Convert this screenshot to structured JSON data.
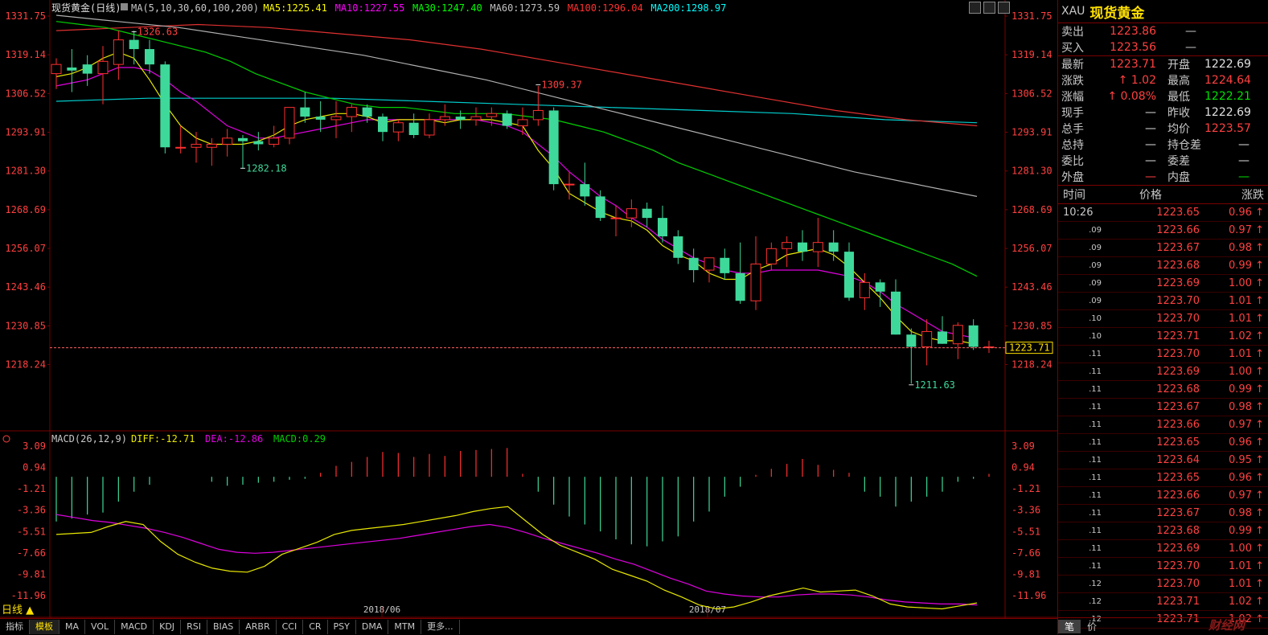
{
  "chart_title": {
    "symbol": "现货黄金",
    "period": "日线",
    "ma_spec": "MA(5,10,30,60,100,200)",
    "ma": [
      {
        "label": "MA5:1225.41",
        "color": "#ffff00"
      },
      {
        "label": "MA10:1227.55",
        "color": "#ff00ff"
      },
      {
        "label": "MA30:1247.40",
        "color": "#00ff00"
      },
      {
        "label": "MA60:1273.59",
        "color": "#c0c0c0"
      },
      {
        "label": "MA100:1296.04",
        "color": "#ff3030"
      },
      {
        "label": "MA200:1298.97",
        "color": "#00ffff"
      }
    ]
  },
  "macd_title": {
    "spec": "MACD(26,12,9)",
    "diff": "DIFF:-12.71",
    "dea": "DEA:-12.86",
    "macd": "MACD:0.29"
  },
  "chart_data": {
    "type": "candlestick",
    "y_labels": [
      "1331.75",
      "1319.14",
      "1306.52",
      "1293.91",
      "1281.30",
      "1268.69",
      "1256.07",
      "1243.46",
      "1230.85",
      "1218.24"
    ],
    "ylim": [
      1210,
      1331.75
    ],
    "x_labels": [
      "2018/06",
      "2018/07"
    ],
    "current_price": "1223.71",
    "annotations": [
      {
        "label": "1326.63",
        "index": 5,
        "price": 1326.63
      },
      {
        "label": "1282.18",
        "index": 12,
        "price": 1282.18
      },
      {
        "label": "1309.37",
        "index": 31,
        "price": 1309.37
      },
      {
        "label": "1211.63",
        "index": 55,
        "price": 1211.63
      }
    ],
    "candles": [
      [
        1313,
        1318,
        1308,
        1316
      ],
      [
        1315,
        1321,
        1307,
        1314
      ],
      [
        1316,
        1319,
        1309,
        1313
      ],
      [
        1313,
        1322,
        1303,
        1317
      ],
      [
        1316,
        1327,
        1311,
        1324
      ],
      [
        1324,
        1327,
        1316,
        1321
      ],
      [
        1321,
        1324,
        1313,
        1316
      ],
      [
        1316,
        1317,
        1287,
        1289
      ],
      [
        1289,
        1296,
        1287,
        1289
      ],
      [
        1289,
        1294,
        1284,
        1290
      ],
      [
        1289,
        1292,
        1283,
        1290
      ],
      [
        1290,
        1295,
        1286,
        1292
      ],
      [
        1292,
        1293,
        1282,
        1291
      ],
      [
        1291,
        1294,
        1288,
        1290
      ],
      [
        1290,
        1296,
        1289,
        1292
      ],
      [
        1292,
        1302,
        1290,
        1302
      ],
      [
        1302,
        1307,
        1297,
        1299
      ],
      [
        1299,
        1304,
        1294,
        1298
      ],
      [
        1298,
        1304,
        1292,
        1299
      ],
      [
        1299,
        1303,
        1294,
        1302
      ],
      [
        1302,
        1303,
        1297,
        1299
      ],
      [
        1299,
        1300,
        1291,
        1294
      ],
      [
        1294,
        1298,
        1291,
        1297
      ],
      [
        1297,
        1300,
        1292,
        1293
      ],
      [
        1293,
        1300,
        1292,
        1298
      ],
      [
        1298,
        1303,
        1296,
        1299
      ],
      [
        1299,
        1301,
        1295,
        1298
      ],
      [
        1298,
        1302,
        1296,
        1299
      ],
      [
        1299,
        1302,
        1296,
        1300
      ],
      [
        1300,
        1301,
        1295,
        1296
      ],
      [
        1296,
        1302,
        1293,
        1298
      ],
      [
        1298,
        1309,
        1296,
        1301
      ],
      [
        1301,
        1302,
        1275,
        1277
      ],
      [
        1277,
        1281,
        1272,
        1277
      ],
      [
        1277,
        1284,
        1270,
        1273
      ],
      [
        1273,
        1275,
        1265,
        1266
      ],
      [
        1266,
        1270,
        1260,
        1266
      ],
      [
        1266,
        1272,
        1263,
        1269
      ],
      [
        1269,
        1271,
        1263,
        1266
      ],
      [
        1266,
        1270,
        1258,
        1260
      ],
      [
        1260,
        1262,
        1251,
        1253
      ],
      [
        1253,
        1256,
        1245,
        1249
      ],
      [
        1249,
        1253,
        1245,
        1253
      ],
      [
        1253,
        1256,
        1246,
        1248
      ],
      [
        1248,
        1258,
        1238,
        1239
      ],
      [
        1239,
        1260,
        1236,
        1251
      ],
      [
        1251,
        1258,
        1249,
        1256
      ],
      [
        1256,
        1260,
        1250,
        1258
      ],
      [
        1258,
        1262,
        1252,
        1255
      ],
      [
        1255,
        1266,
        1250,
        1258
      ],
      [
        1258,
        1262,
        1252,
        1255
      ],
      [
        1255,
        1258,
        1239,
        1240
      ],
      [
        1240,
        1248,
        1236,
        1245
      ],
      [
        1245,
        1246,
        1237,
        1242
      ],
      [
        1242,
        1246,
        1228,
        1228
      ],
      [
        1228,
        1230,
        1212,
        1224
      ],
      [
        1224,
        1233,
        1218,
        1229
      ],
      [
        1229,
        1234,
        1225,
        1225
      ],
      [
        1225,
        1232,
        1220,
        1231
      ],
      [
        1231,
        1233,
        1223,
        1224
      ],
      [
        1224,
        1226,
        1222,
        1224
      ]
    ],
    "ma5": [
      1312,
      1313,
      1315,
      1318,
      1320,
      1318,
      1311,
      1303,
      1296,
      1292,
      1290,
      1290,
      1290,
      1291,
      1293,
      1296,
      1298,
      1299,
      1300,
      1300,
      1299,
      1297,
      1298,
      1298,
      1298,
      1297,
      1298,
      1298,
      1298,
      1297,
      1296,
      1288,
      1282,
      1274,
      1271,
      1268,
      1266,
      1265,
      1262,
      1257,
      1254,
      1252,
      1248,
      1246,
      1246,
      1249,
      1251,
      1254,
      1255,
      1256,
      1254,
      1250,
      1245,
      1240,
      1234,
      1229,
      1227,
      1226,
      1226,
      1225
    ],
    "ma10": [
      1309,
      1310,
      1311,
      1313,
      1315,
      1315,
      1314,
      1311,
      1307,
      1304,
      1300,
      1296,
      1294,
      1292,
      1292,
      1293,
      1294,
      1295,
      1296,
      1297,
      1298,
      1298,
      1298,
      1298,
      1298,
      1298,
      1298,
      1298,
      1297,
      1296,
      1294,
      1290,
      1286,
      1281,
      1277,
      1273,
      1270,
      1266,
      1263,
      1259,
      1256,
      1253,
      1251,
      1249,
      1248,
      1248,
      1249,
      1249,
      1249,
      1249,
      1248,
      1247,
      1245,
      1242,
      1238,
      1235,
      1232,
      1229,
      1228,
      1227
    ],
    "ma30": [
      1330,
      1329,
      1328,
      1326,
      1324,
      1322,
      1320,
      1317,
      1313,
      1310,
      1307,
      1305,
      1303,
      1302,
      1302,
      1301,
      1300,
      1300,
      1300,
      1299,
      1298,
      1296,
      1294,
      1291,
      1288,
      1284,
      1281,
      1278,
      1275,
      1272,
      1269,
      1266,
      1263,
      1260,
      1257,
      1254,
      1251,
      1247
    ],
    "ma60": [
      1332,
      1330,
      1328,
      1325,
      1322,
      1319,
      1315,
      1311,
      1306,
      1301,
      1296,
      1291,
      1286,
      1281,
      1277,
      1273
    ],
    "ma100": [
      1327,
      1328,
      1329,
      1328,
      1326,
      1324,
      1321,
      1317,
      1313,
      1309,
      1305,
      1301,
      1298,
      1296
    ],
    "ma200": [
      1304,
      1305,
      1305,
      1305,
      1304,
      1303,
      1302,
      1301,
      1300,
      1298,
      1297
    ],
    "macd_y_labels": [
      "3.09",
      "0.94",
      "-1.21",
      "-3.36",
      "-5.51",
      "-7.66",
      "-9.81",
      "-11.96"
    ],
    "macd_ylim": [
      -13.5,
      3.09
    ],
    "macd_hist": [
      -4.5,
      -4.2,
      -3.8,
      -3.6,
      -2.5,
      -1.5,
      -0.8,
      0,
      0,
      0,
      -0.5,
      -0.9,
      -0.8,
      -0.6,
      -0.5,
      -0.3,
      -0.2,
      0.4,
      1.1,
      1.5,
      2.0,
      2.5,
      2.4,
      2.0,
      2.3,
      2.1,
      2.6,
      2.7,
      2.8,
      2.9,
      0.3,
      -1.5,
      -2.8,
      -4.0,
      -4.8,
      -5.5,
      -6.3,
      -6.8,
      -7.0,
      -6.5,
      -6.0,
      -4.5,
      -3.5,
      -2.0,
      -1.0,
      0.2,
      0.8,
      1.3,
      1.8,
      1.2,
      0.7,
      0.4,
      -1.5,
      -2.0,
      -3.0,
      -2.5,
      -2.0,
      -1.5,
      -0.5,
      -0.2,
      0.3
    ],
    "diff": [
      -5.8,
      -5.7,
      -5.6,
      -5.0,
      -4.5,
      -4.8,
      -6.5,
      -7.8,
      -8.6,
      -9.2,
      -9.5,
      -9.6,
      -9.0,
      -7.8,
      -7.2,
      -6.6,
      -5.8,
      -5.4,
      -5.2,
      -5.0,
      -4.8,
      -4.5,
      -4.2,
      -3.9,
      -3.5,
      -3.2,
      -3.0,
      -4.4,
      -5.8,
      -6.9,
      -7.6,
      -8.3,
      -9.3,
      -9.9,
      -10.5,
      -11.4,
      -12.1,
      -12.9,
      -13.3,
      -13.1,
      -12.6,
      -12.0,
      -11.6,
      -11.2,
      -11.6,
      -11.5,
      -11.4,
      -12.0,
      -12.8,
      -13.1,
      -13.2,
      -13.3,
      -13.0,
      -12.7
    ],
    "dea": [
      -3.8,
      -4.1,
      -4.4,
      -4.6,
      -4.9,
      -5.2,
      -5.6,
      -6.1,
      -6.7,
      -7.3,
      -7.6,
      -7.7,
      -7.6,
      -7.4,
      -7.2,
      -7.0,
      -6.8,
      -6.6,
      -6.4,
      -6.2,
      -5.9,
      -5.6,
      -5.3,
      -5.0,
      -4.8,
      -5.1,
      -5.6,
      -6.2,
      -6.7,
      -7.2,
      -7.7,
      -8.3,
      -8.8,
      -9.5,
      -10.2,
      -10.8,
      -11.5,
      -11.8,
      -12.0,
      -12.1,
      -12.1,
      -11.9,
      -11.8,
      -11.8,
      -11.9,
      -12.1,
      -12.4,
      -12.6,
      -12.7,
      -12.8,
      -12.8,
      -12.9
    ],
    "colors": {
      "up": "#ff3030",
      "down": "#3ed99a",
      "flat": "#ff3030"
    }
  },
  "side": {
    "code": "XAU",
    "name": "现货黄金",
    "top_rows": [
      {
        "label": "卖出",
        "value": "1223.86",
        "dash": "—"
      },
      {
        "label": "买入",
        "value": "1223.56",
        "dash": "—"
      }
    ],
    "stats": [
      {
        "l1": "最新",
        "v1": "1223.71",
        "c1": "red",
        "l2": "开盘",
        "v2": "1222.69",
        "c2": "white"
      },
      {
        "l1": "涨跌",
        "v1": "1.02",
        "c1": "red",
        "arrow": "↑",
        "l2": "最高",
        "v2": "1224.64",
        "c2": "red"
      },
      {
        "l1": "涨幅",
        "v1": "0.08%",
        "c1": "red",
        "arrow": "↑",
        "l2": "最低",
        "v2": "1222.21",
        "c2": "green"
      },
      {
        "l1": "现手",
        "v1": "—",
        "c1": "white",
        "l2": "昨收",
        "v2": "1222.69",
        "c2": "white"
      },
      {
        "l1": "总手",
        "v1": "—",
        "c1": "white",
        "l2": "均价",
        "v2": "1223.57",
        "c2": "red"
      },
      {
        "l1": "总持",
        "v1": "—",
        "c1": "white",
        "l2": "持仓差",
        "v2": "—",
        "c2": "white"
      },
      {
        "l1": "委比",
        "v1": "—",
        "c1": "white",
        "l2": "委差",
        "v2": "—",
        "c2": "white"
      },
      {
        "l1": "外盘",
        "v1": "—",
        "c1": "red",
        "l2": "内盘",
        "v2": "—",
        "c2": "green"
      }
    ],
    "tick_header": {
      "time": "时间",
      "price": "价格",
      "change": "涨跌"
    },
    "ticks": [
      {
        "time": "10:26",
        "price": "1223.65",
        "chg": "0.96"
      },
      {
        "time": ".09",
        "price": "1223.66",
        "chg": "0.97"
      },
      {
        "time": ".09",
        "price": "1223.67",
        "chg": "0.98"
      },
      {
        "time": ".09",
        "price": "1223.68",
        "chg": "0.99"
      },
      {
        "time": ".09",
        "price": "1223.69",
        "chg": "1.00"
      },
      {
        "time": ".09",
        "price": "1223.70",
        "chg": "1.01"
      },
      {
        "time": ".10",
        "price": "1223.70",
        "chg": "1.01"
      },
      {
        "time": ".10",
        "price": "1223.71",
        "chg": "1.02"
      },
      {
        "time": ".11",
        "price": "1223.70",
        "chg": "1.01"
      },
      {
        "time": ".11",
        "price": "1223.69",
        "chg": "1.00"
      },
      {
        "time": ".11",
        "price": "1223.68",
        "chg": "0.99"
      },
      {
        "time": ".11",
        "price": "1223.67",
        "chg": "0.98"
      },
      {
        "time": ".11",
        "price": "1223.66",
        "chg": "0.97"
      },
      {
        "time": ".11",
        "price": "1223.65",
        "chg": "0.96"
      },
      {
        "time": ".11",
        "price": "1223.64",
        "chg": "0.95"
      },
      {
        "time": ".11",
        "price": "1223.65",
        "chg": "0.96"
      },
      {
        "time": ".11",
        "price": "1223.66",
        "chg": "0.97"
      },
      {
        "time": ".11",
        "price": "1223.67",
        "chg": "0.98"
      },
      {
        "time": ".11",
        "price": "1223.68",
        "chg": "0.99"
      },
      {
        "time": ".11",
        "price": "1223.69",
        "chg": "1.00"
      },
      {
        "time": ".11",
        "price": "1223.70",
        "chg": "1.01"
      },
      {
        "time": ".12",
        "price": "1223.70",
        "chg": "1.01"
      },
      {
        "time": ".12",
        "price": "1223.71",
        "chg": "1.02"
      },
      {
        "time": ".12",
        "price": "1223.71",
        "chg": "1.02"
      }
    ],
    "bottom_tabs": [
      "笔",
      "价"
    ],
    "watermark": "财经网"
  },
  "bottom_tabs": [
    "指标",
    "模板",
    "MA",
    "VOL",
    "MACD",
    "KDJ",
    "RSI",
    "BIAS",
    "ARBR",
    "CCI",
    "CR",
    "PSY",
    "DMA",
    "MTM",
    "更多..."
  ],
  "period_label": "日线 ▲"
}
